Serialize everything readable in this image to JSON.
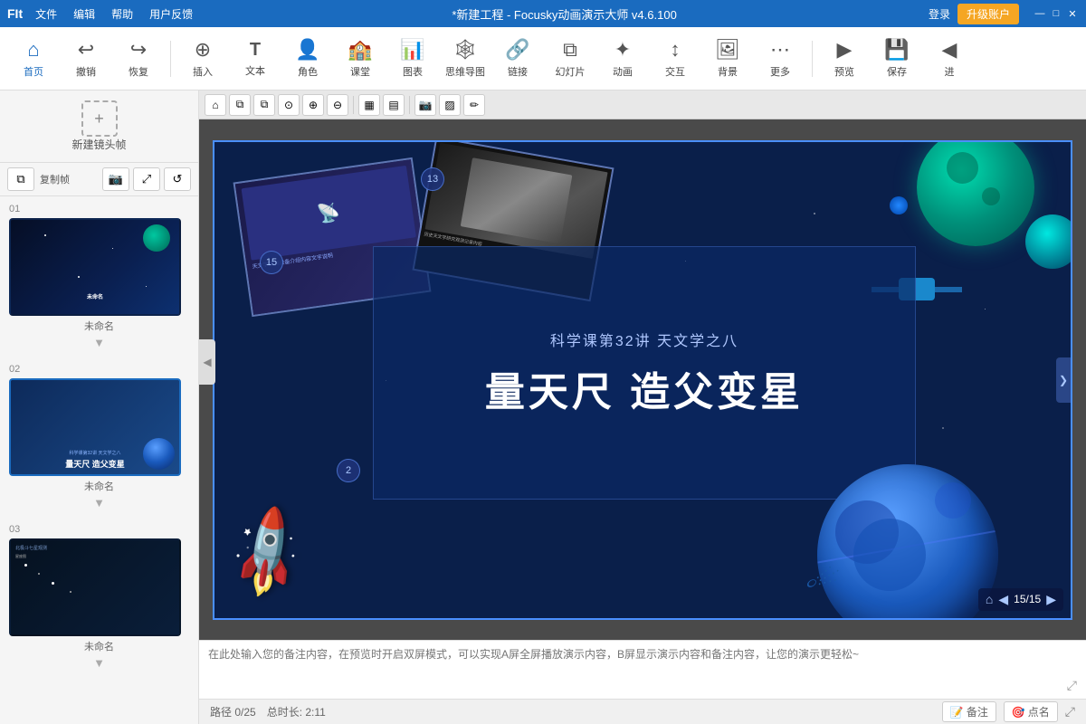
{
  "app": {
    "title": "*新建工程 - Focusky动画演示大师  v4.6.100",
    "logo": "FIt"
  },
  "titlebar": {
    "menu": [
      "文件",
      "编辑",
      "帮助",
      "用户反馈"
    ],
    "login": "登录",
    "upgrade": "升级账户",
    "window_min": "—",
    "window_max": "□",
    "window_close": "✕"
  },
  "toolbar": {
    "items": [
      {
        "id": "home",
        "icon": "⌂",
        "label": "首页",
        "active": true
      },
      {
        "id": "undo",
        "icon": "↩",
        "label": "撤销",
        "active": false
      },
      {
        "id": "redo",
        "icon": "↪",
        "label": "恢复",
        "active": true
      },
      {
        "id": "insert",
        "icon": "⊕",
        "label": "插入",
        "active": false
      },
      {
        "id": "text",
        "icon": "T",
        "label": "文本",
        "active": false
      },
      {
        "id": "role",
        "icon": "☺",
        "label": "角色",
        "active": false
      },
      {
        "id": "classroom",
        "icon": "▦",
        "label": "课堂",
        "active": false
      },
      {
        "id": "chart",
        "icon": "📊",
        "label": "图表",
        "active": false
      },
      {
        "id": "mindmap",
        "icon": "⌘",
        "label": "思维导图",
        "active": false
      },
      {
        "id": "link",
        "icon": "🔗",
        "label": "链接",
        "active": false
      },
      {
        "id": "slide",
        "icon": "▶",
        "label": "幻灯片",
        "active": false
      },
      {
        "id": "animation",
        "icon": "✦",
        "label": "动画",
        "active": false
      },
      {
        "id": "interact",
        "icon": "↕",
        "label": "交互",
        "active": false
      },
      {
        "id": "background",
        "icon": "🖼",
        "label": "背景",
        "active": false
      },
      {
        "id": "more",
        "icon": "⋯",
        "label": "更多",
        "active": false
      },
      {
        "id": "preview",
        "icon": "▶",
        "label": "预览",
        "active": false
      },
      {
        "id": "save",
        "icon": "💾",
        "label": "保存",
        "active": false
      },
      {
        "id": "nav",
        "icon": "◀",
        "label": "进",
        "active": false
      }
    ]
  },
  "sidebar": {
    "new_frame_label": "新建镜头帧",
    "tools": [
      "复制帧",
      "📷",
      "⤢",
      "⤿"
    ],
    "slides": [
      {
        "num": "01",
        "name": "未命名",
        "bg": "dark-space"
      },
      {
        "num": "02",
        "name": "未命名",
        "bg": "blue-space"
      },
      {
        "num": "03",
        "name": "未命名",
        "bg": "darkest-space"
      }
    ],
    "collapse_icon": "◀"
  },
  "canvas_toolbar": {
    "buttons": [
      "⌂",
      "☐",
      "☐",
      "⊙",
      "⊕",
      "⊖",
      "▦",
      "▤",
      "📷",
      "▨",
      "✏"
    ]
  },
  "slide": {
    "subtitle": "科学课第32讲  天文学之八",
    "title": "量天尺 造父变星",
    "badge_13": "13",
    "badge_15": "15",
    "badge_2": "2",
    "nav_current": "15",
    "nav_total": "15"
  },
  "notes": {
    "placeholder": "在此处输入您的备注内容，在预览时开启双屏模式，可以实现A屏全屏播放演示内容，B屏显示演示内容和备注内容，让您的演示更轻松~"
  },
  "statusbar": {
    "path": "路径  0/25",
    "duration": "总时长: 2:11",
    "notes_btn": "备注",
    "points_btn": "点名",
    "slide_current": "15",
    "slide_total": "15"
  },
  "colors": {
    "primary": "#1a6bbf",
    "accent": "#f5a623",
    "canvas_bg": "#0a1f4a",
    "slide_border": "#4a8fff"
  }
}
